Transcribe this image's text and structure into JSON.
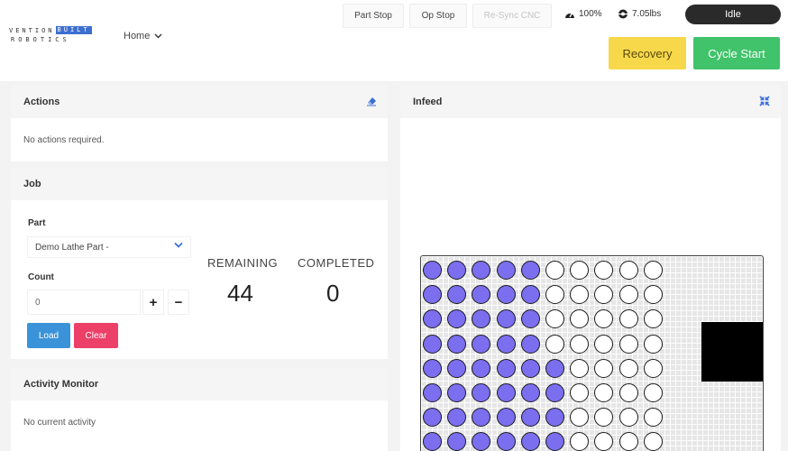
{
  "header": {
    "logo_line1": "VENTION",
    "logo_box": "BUILT",
    "logo_line2": "ROBOTICS",
    "nav_home": "Home",
    "part_stop": "Part Stop",
    "op_stop": "Op Stop",
    "resync": "Re-Sync CNC",
    "speed": "100%",
    "weight": "7.05lbs",
    "status": "Idle",
    "recovery": "Recovery",
    "cycle_start": "Cycle Start"
  },
  "actions": {
    "title": "Actions",
    "message": "No actions required."
  },
  "job": {
    "title": "Job",
    "part_label": "Part",
    "part_value": "Demo Lathe Part -",
    "count_label": "Count",
    "count_value": "0",
    "plus": "+",
    "minus": "−",
    "load": "Load",
    "clear": "Clear",
    "remaining_label": "REMAINING",
    "remaining_value": "44",
    "completed_label": "COMPLETED",
    "completed_value": "0"
  },
  "activity": {
    "title": "Activity Monitor",
    "message": "No current activity"
  },
  "infeed": {
    "title": "Infeed",
    "grid": {
      "cols": 10,
      "rows": 8,
      "filled_per_row": [
        5,
        5,
        5,
        5,
        6,
        6,
        6,
        6
      ]
    }
  },
  "colors": {
    "accent_blue": "#3a93d8",
    "danger": "#ec4068",
    "recovery_yellow": "#f7d84a",
    "cycle_green": "#40c36a",
    "slot_purple": "#7b6ff0"
  }
}
